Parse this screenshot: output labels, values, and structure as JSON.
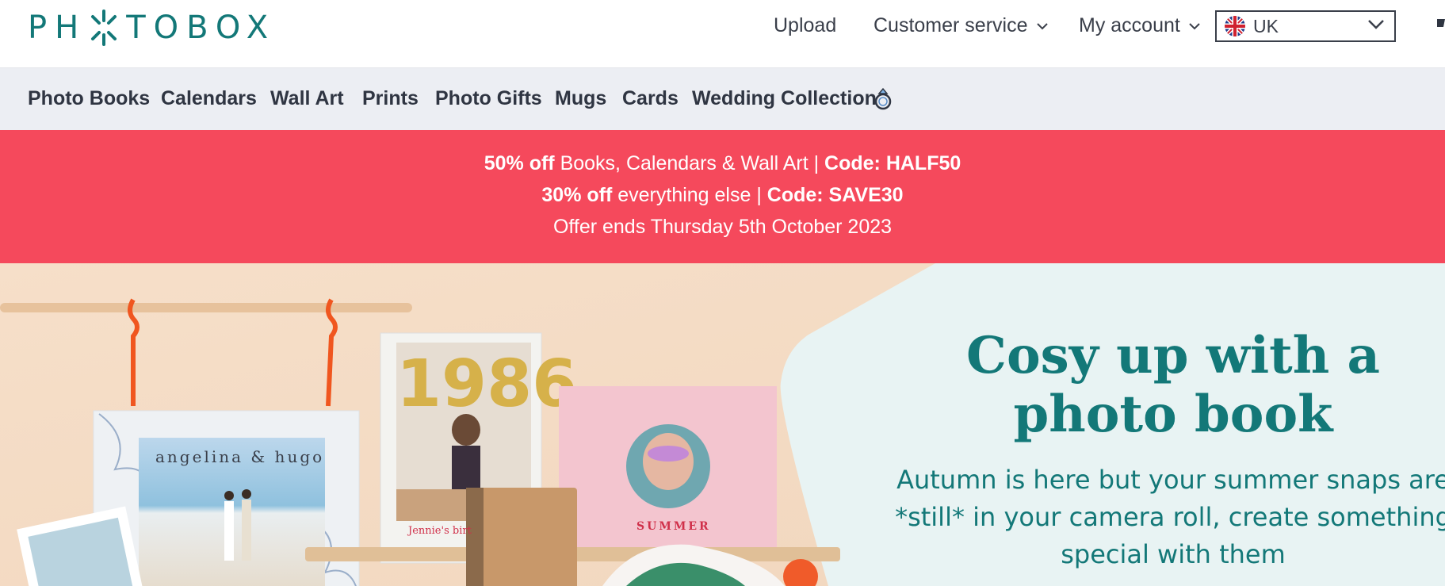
{
  "brand": {
    "name": "PHOTOBOX",
    "color": "#137878"
  },
  "header": {
    "links": [
      {
        "label": "Upload"
      },
      {
        "label": "Customer service",
        "icon": "chevron-down-icon"
      },
      {
        "label": "My account",
        "icon": "chevron-down-icon"
      }
    ],
    "country": {
      "flag": "uk-flag-icon",
      "value": "UK"
    }
  },
  "categories": [
    {
      "label": "Photo Books"
    },
    {
      "label": "Calendars"
    },
    {
      "label": "Wall Art"
    },
    {
      "label": "Prints"
    },
    {
      "label": "Photo Gifts"
    },
    {
      "label": "Mugs"
    },
    {
      "label": "Cards"
    },
    {
      "label": "Wedding Collection",
      "icon": "ring-icon"
    }
  ],
  "promo": {
    "background": "#f5495c",
    "line1": {
      "bold": "50% off",
      "text": " Books, Calendars & Wall Art | ",
      "code": "Code: HALF50"
    },
    "line2": {
      "bold": "30% off",
      "text": " everything else | ",
      "code": "Code: SAVE30"
    },
    "line3": "Offer ends Thursday 5th October 2023"
  },
  "hero": {
    "title_line1": "Cosy up with a",
    "title_line2": "photo book",
    "subtitle_line1": "Autumn is here but your summer snaps are",
    "subtitle_line2": "*still* in your camera roll, create something",
    "subtitle_line3": "special with them",
    "covers": {
      "wedding": "angelina & hugo",
      "birthday_digits": "1986",
      "birthday_caption": "Jennie's birt",
      "summer": "SUMMER"
    }
  }
}
